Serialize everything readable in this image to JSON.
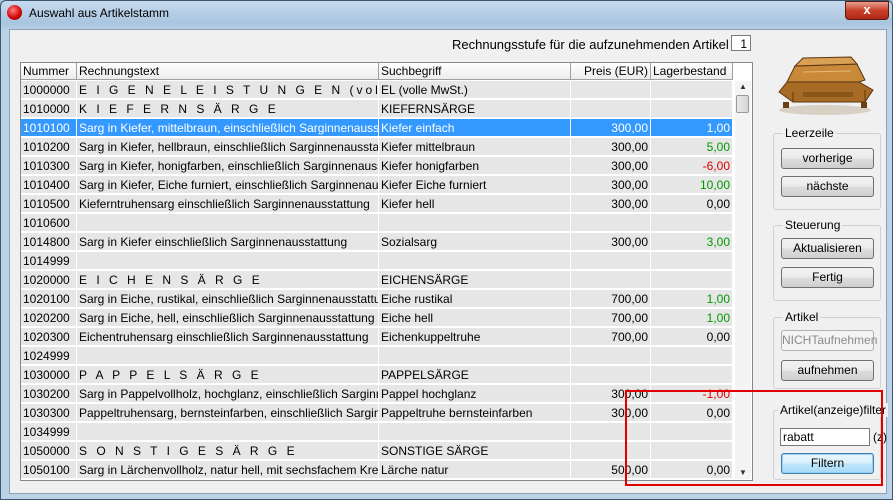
{
  "window": {
    "title": "Auswahl aus Artikelstamm",
    "close_label": "x"
  },
  "stufe": {
    "label": "Rechnungsstufe für die aufzunehmenden Artikel",
    "value": "1"
  },
  "table": {
    "headers": [
      "Nummer",
      "Rechnungstext",
      "Suchbegriff",
      "Preis (EUR)",
      "Lagerbestand"
    ],
    "rows": [
      {
        "nummer": "1000000",
        "text": "E I G E N E   L E I S T U N G E N   (volle MwSt.)",
        "such": "EL (volle MwSt.)",
        "preis": "",
        "lager": "",
        "lager_color": "",
        "group": true
      },
      {
        "nummer": "1010000",
        "text": "K I E F E R N S Ä R G E",
        "such": "KIEFERNSÄRGE",
        "preis": "",
        "lager": "",
        "lager_color": "",
        "group": true
      },
      {
        "nummer": "1010100",
        "text": "Sarg in Kiefer, mittelbraun, einschließlich Sarginnenausstattung",
        "such": "Kiefer einfach",
        "preis": "300,00",
        "lager": "1,00",
        "lager_color": "",
        "selected": true
      },
      {
        "nummer": "1010200",
        "text": "Sarg in Kiefer, hellbraun, einschließlich Sarginnenausstattung",
        "such": "Kiefer mittelbraun",
        "preis": "300,00",
        "lager": "5,00",
        "lager_color": "green"
      },
      {
        "nummer": "1010300",
        "text": "Sarg in Kiefer, honigfarben, einschließlich Sarginnenausstattung",
        "such": "Kiefer honigfarben",
        "preis": "300,00",
        "lager": "-6,00",
        "lager_color": "red"
      },
      {
        "nummer": "1010400",
        "text": "Sarg in Kiefer, Eiche furniert, einschließlich Sarginnenausstattung",
        "such": "Kiefer Eiche furniert",
        "preis": "300,00",
        "lager": "10,00",
        "lager_color": "green"
      },
      {
        "nummer": "1010500",
        "text": "Kieferntruhensarg einschließlich Sarginnenausstattung",
        "such": "Kiefer hell",
        "preis": "300,00",
        "lager": "0,00",
        "lager_color": ""
      },
      {
        "nummer": "1010600",
        "text": "",
        "such": "",
        "preis": "",
        "lager": "",
        "lager_color": ""
      },
      {
        "nummer": "1014800",
        "text": "Sarg in Kiefer einschließlich Sarginnenausstattung",
        "such": "Sozialsarg",
        "preis": "300,00",
        "lager": "3,00",
        "lager_color": "green"
      },
      {
        "nummer": "1014999",
        "text": "",
        "such": "",
        "preis": "",
        "lager": "",
        "lager_color": ""
      },
      {
        "nummer": "1020000",
        "text": "E I C H E N S Ä R G E",
        "such": "EICHENSÄRGE",
        "preis": "",
        "lager": "",
        "lager_color": "",
        "group": true
      },
      {
        "nummer": "1020100",
        "text": "Sarg in Eiche, rustikal, einschließlich Sarginnenausstattung",
        "such": "Eiche rustikal",
        "preis": "700,00",
        "lager": "1,00",
        "lager_color": "green"
      },
      {
        "nummer": "1020200",
        "text": "Sarg in Eiche, hell, einschließlich Sarginnenausstattung",
        "such": "Eiche hell",
        "preis": "700,00",
        "lager": "1,00",
        "lager_color": "green"
      },
      {
        "nummer": "1020300",
        "text": "Eichentruhensarg einschließlich Sarginnenausstattung",
        "such": "Eichenkuppeltruhe",
        "preis": "700,00",
        "lager": "0,00",
        "lager_color": ""
      },
      {
        "nummer": "1024999",
        "text": "",
        "such": "",
        "preis": "",
        "lager": "",
        "lager_color": ""
      },
      {
        "nummer": "1030000",
        "text": "P A P P E L S Ä R G E",
        "such": "PAPPELSÄRGE",
        "preis": "",
        "lager": "",
        "lager_color": "",
        "group": true
      },
      {
        "nummer": "1030200",
        "text": "Sarg in Pappelvollholz, hochglanz, einschließlich Sarginnenausstattung",
        "such": "Pappel hochglanz",
        "preis": "300,00",
        "lager": "-1,00",
        "lager_color": "red"
      },
      {
        "nummer": "1030300",
        "text": "Pappeltruhensarg, bernsteinfarben, einschließlich Sarginnenausstattung",
        "such": "Pappeltruhe bernsteinfarben",
        "preis": "300,00",
        "lager": "0,00",
        "lager_color": ""
      },
      {
        "nummer": "1034999",
        "text": "",
        "such": "",
        "preis": "",
        "lager": "",
        "lager_color": ""
      },
      {
        "nummer": "1050000",
        "text": "S O N S T I G E   S Ä R G E",
        "such": "SONSTIGE SÄRGE",
        "preis": "",
        "lager": "",
        "lager_color": "",
        "group": true
      },
      {
        "nummer": "1050100",
        "text": "Sarg in Lärchenvollholz, natur hell, mit sechsfachem Kreuz",
        "such": "Lärche natur",
        "preis": "500,00",
        "lager": "0,00",
        "lager_color": ""
      }
    ]
  },
  "leerzeile": {
    "label": "Leerzeile",
    "prev": "vorherige",
    "next": "nächste"
  },
  "steuerung": {
    "label": "Steuerung",
    "refresh": "Aktualisieren",
    "done": "Fertig"
  },
  "artikel": {
    "label": "Artikel",
    "not_add": "NICHTaufnehmen",
    "add": "aufnehmen"
  },
  "filter": {
    "label": "Artikel(anzeige)filter",
    "value": "rabatt",
    "z_label": "(z)",
    "button": "Filtern"
  },
  "colors": {
    "selection": "#3399ff",
    "positive": "#009900",
    "negative": "#e00000",
    "highlight": "#e00000"
  }
}
